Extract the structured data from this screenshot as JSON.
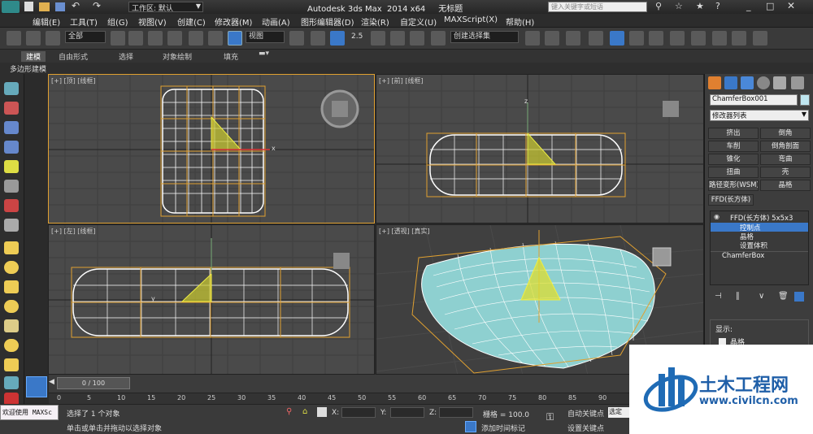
{
  "window": {
    "title": "Autodesk 3ds Max  2014 x64     无标题",
    "workspace_label": "工作区: 默认",
    "search_placeholder": "键入关键字或短语"
  },
  "menu": [
    "编辑(E)",
    "工具(T)",
    "组(G)",
    "视图(V)",
    "创建(C)",
    "修改器(M)",
    "动画(A)",
    "图形编辑器(D)",
    "渲染(R)",
    "自定义(U)",
    "MAXScript(X)",
    "帮助(H)"
  ],
  "toolbar": {
    "selection_filter": "全部",
    "ref_coord": "视图",
    "named_selection": "创建选择集",
    "snap_value": "2.5"
  },
  "ribbon": {
    "tabs": [
      "建模",
      "自由形式",
      "选择",
      "对象绘制",
      "填充"
    ],
    "sub_label": "多边形建模"
  },
  "viewports": {
    "top": "[+] [顶] [线框]",
    "front": "[+] [前] [线框]",
    "left": "[+] [左] [线框]",
    "persp": "[+] [透视] [真实]",
    "axis_x": "x",
    "axis_y": "y",
    "axis_z": "z"
  },
  "command_panel": {
    "object_name": "ChamferBox001",
    "modifier_list": "修改器列表",
    "buttons": [
      [
        "挤出",
        "倒角"
      ],
      [
        "车削",
        "倒角剖面"
      ],
      [
        "锥化",
        "弯曲"
      ],
      [
        "扭曲",
        "壳"
      ],
      [
        "路径变形(WSM)",
        "晶格"
      ]
    ],
    "ffd_button": "FFD(长方体)",
    "stack": [
      "FFD(长方体) 5x5x3",
      "控制点",
      "晶格",
      "设置体积",
      "ChamferBox"
    ],
    "display_label": "显示:",
    "lattice_label": "晶格"
  },
  "timeline": {
    "frame": "0 / 100",
    "ticks": [
      "0",
      "5",
      "10",
      "15",
      "20",
      "25",
      "30",
      "35",
      "40",
      "45",
      "50",
      "55",
      "60",
      "65",
      "70",
      "75",
      "80",
      "85",
      "90"
    ]
  },
  "status": {
    "selected": "选择了 1 个对象",
    "prompt": "单击或单击并拖动以选择对象",
    "welcome": "欢迎使用 MAXSc",
    "x_label": "X:",
    "y_label": "Y:",
    "z_label": "Z:",
    "grid": "栅格 = 100.0",
    "auto_key": "自动关键点",
    "set_key": "设置关键点",
    "add_time_tag": "添加时间标记",
    "select_label": "选定"
  },
  "watermark": {
    "name": "土木工程网",
    "url": "www.civilcn.com"
  },
  "colors": {
    "accent": "#f0a030",
    "selected_blue": "#3a78c8",
    "lattice_orange": "#e0a030",
    "mesh_cyan": "#8ed0d0"
  }
}
